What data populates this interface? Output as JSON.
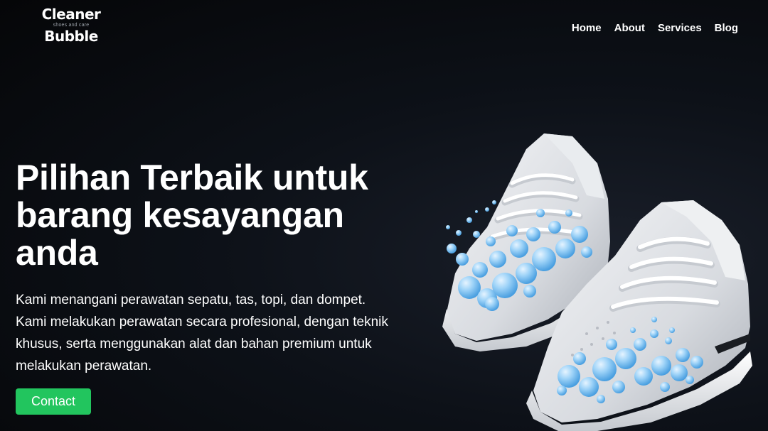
{
  "brand": {
    "name_top": "Cleaner",
    "tagline": "shoes and care",
    "name_bottom": "Bubble"
  },
  "nav": {
    "items": [
      {
        "label": "Home"
      },
      {
        "label": "About"
      },
      {
        "label": "Services"
      },
      {
        "label": "Blog"
      }
    ]
  },
  "hero": {
    "title": "Pilihan Terbaik untuk barang kesayangan anda",
    "description": "Kami menangani perawatan sepatu, tas, topi, dan dompet. Kami melakukan perawatan secara profesional, dengan teknik khusus, serta menggunakan alat dan bahan premium untuk melakukan perawatan.",
    "cta_label": "Contact",
    "image": "white-sneakers-with-foam-bubbles"
  },
  "colors": {
    "background": "#07090d",
    "accent": "#22c55e",
    "text": "#ffffff",
    "bubble": "#8ec9f5"
  }
}
